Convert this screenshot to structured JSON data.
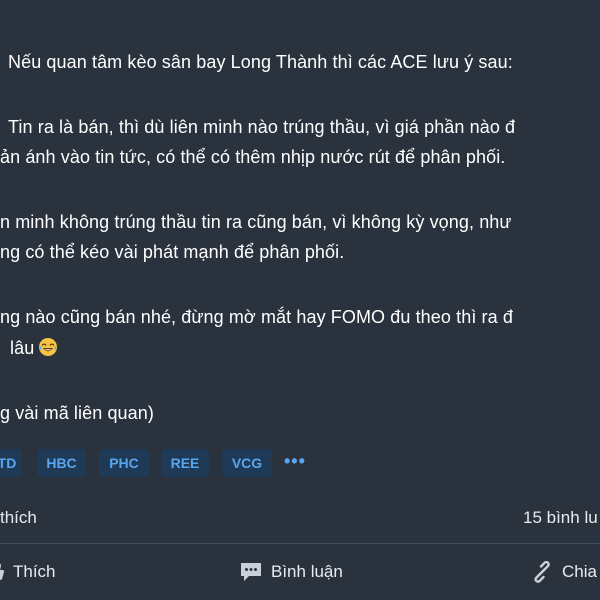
{
  "post": {
    "lines": [
      "Nếu quan tâm kèo sân bay Long Thành thì các ACE lưu ý sau:",
      "Tin ra là bán, thì dù liên minh nào trúng thầu, vì giá phần nào đ",
      "ản ánh vào tin tức, có thể có thêm nhịp nước rút để phân phối.",
      "n minh không trúng thầu tin ra cũng bán, vì không kỳ vọng, như",
      "ng có thể kéo vài phát mạnh để phân phối.",
      "ng nào cũng bán nhé, đừng mờ mắt hay FOMO đu theo thì ra đ",
      "lâu",
      "g vài mã liên quan)"
    ],
    "emoji_icon": "laughing-tears-emoji"
  },
  "tags": [
    "TD",
    "HBC",
    "PHC",
    "REE",
    "VCG"
  ],
  "tags_more": "•••",
  "stats": {
    "likes": "thích",
    "comments": "15 bình lu"
  },
  "actions": {
    "like": "Thích",
    "comment": "Bình luận",
    "share": "Chia"
  },
  "colors": {
    "background": "#2a323e",
    "tag_background": "#1e3a56",
    "tag_text": "#59a6ee",
    "text": "#ffffff"
  }
}
